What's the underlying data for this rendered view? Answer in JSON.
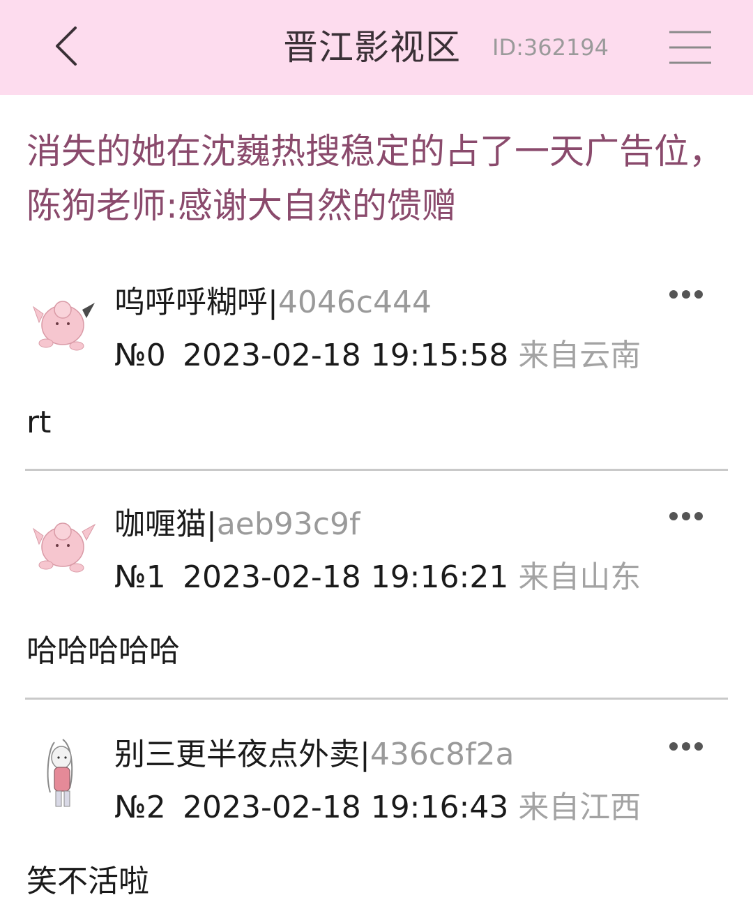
{
  "header": {
    "back_icon": "chevron-left-icon",
    "title": "晋江影视区",
    "board_id": "ID:362194",
    "menu_icon": "hamburger-menu-icon",
    "background_color": "#fddcee"
  },
  "thread": {
    "title": "消失的她在沈巍热搜稳定的占了一天广告位，陈狗老师:感谢大自然的馈赠",
    "title_color": "#8a4a6c"
  },
  "posts": [
    {
      "username": "呜呼呼糊呼",
      "separator": "|",
      "user_id": "4046c444",
      "floor": "№0",
      "datetime": "2023-02-18 19:15:58",
      "location": "来自云南",
      "content": "rt",
      "avatar_icon": "pink-creature-avatar-icon",
      "more_icon": "more-dots-icon"
    },
    {
      "username": "咖喱猫",
      "separator": "|",
      "user_id": "aeb93c9f",
      "floor": "№1",
      "datetime": "2023-02-18 19:16:21",
      "location": "来自山东",
      "content": "哈哈哈哈哈",
      "avatar_icon": "pink-creature-avatar-icon",
      "more_icon": "more-dots-icon"
    },
    {
      "username": "别三更半夜点外卖",
      "separator": "|",
      "user_id": "436c8f2a",
      "floor": "№2",
      "datetime": "2023-02-18 19:16:43",
      "location": "来自江西",
      "content": "笑不活啦",
      "avatar_icon": "bunny-girl-avatar-icon",
      "more_icon": "more-dots-icon"
    }
  ]
}
